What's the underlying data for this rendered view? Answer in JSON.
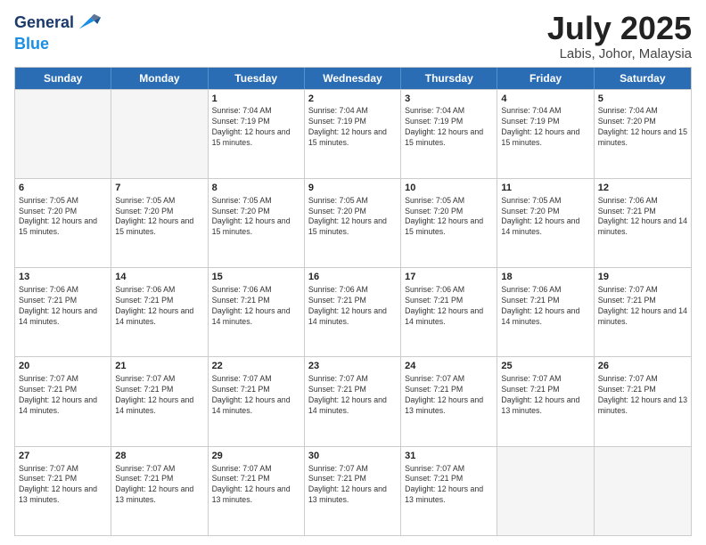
{
  "header": {
    "logo_line1": "General",
    "logo_line2": "Blue",
    "month_title": "July 2025",
    "location": "Labis, Johor, Malaysia"
  },
  "days_of_week": [
    "Sunday",
    "Monday",
    "Tuesday",
    "Wednesday",
    "Thursday",
    "Friday",
    "Saturday"
  ],
  "weeks": [
    [
      {
        "day": "",
        "sunrise": "",
        "sunset": "",
        "daylight": ""
      },
      {
        "day": "",
        "sunrise": "",
        "sunset": "",
        "daylight": ""
      },
      {
        "day": "1",
        "sunrise": "Sunrise: 7:04 AM",
        "sunset": "Sunset: 7:19 PM",
        "daylight": "Daylight: 12 hours and 15 minutes."
      },
      {
        "day": "2",
        "sunrise": "Sunrise: 7:04 AM",
        "sunset": "Sunset: 7:19 PM",
        "daylight": "Daylight: 12 hours and 15 minutes."
      },
      {
        "day": "3",
        "sunrise": "Sunrise: 7:04 AM",
        "sunset": "Sunset: 7:19 PM",
        "daylight": "Daylight: 12 hours and 15 minutes."
      },
      {
        "day": "4",
        "sunrise": "Sunrise: 7:04 AM",
        "sunset": "Sunset: 7:19 PM",
        "daylight": "Daylight: 12 hours and 15 minutes."
      },
      {
        "day": "5",
        "sunrise": "Sunrise: 7:04 AM",
        "sunset": "Sunset: 7:20 PM",
        "daylight": "Daylight: 12 hours and 15 minutes."
      }
    ],
    [
      {
        "day": "6",
        "sunrise": "Sunrise: 7:05 AM",
        "sunset": "Sunset: 7:20 PM",
        "daylight": "Daylight: 12 hours and 15 minutes."
      },
      {
        "day": "7",
        "sunrise": "Sunrise: 7:05 AM",
        "sunset": "Sunset: 7:20 PM",
        "daylight": "Daylight: 12 hours and 15 minutes."
      },
      {
        "day": "8",
        "sunrise": "Sunrise: 7:05 AM",
        "sunset": "Sunset: 7:20 PM",
        "daylight": "Daylight: 12 hours and 15 minutes."
      },
      {
        "day": "9",
        "sunrise": "Sunrise: 7:05 AM",
        "sunset": "Sunset: 7:20 PM",
        "daylight": "Daylight: 12 hours and 15 minutes."
      },
      {
        "day": "10",
        "sunrise": "Sunrise: 7:05 AM",
        "sunset": "Sunset: 7:20 PM",
        "daylight": "Daylight: 12 hours and 15 minutes."
      },
      {
        "day": "11",
        "sunrise": "Sunrise: 7:05 AM",
        "sunset": "Sunset: 7:20 PM",
        "daylight": "Daylight: 12 hours and 14 minutes."
      },
      {
        "day": "12",
        "sunrise": "Sunrise: 7:06 AM",
        "sunset": "Sunset: 7:21 PM",
        "daylight": "Daylight: 12 hours and 14 minutes."
      }
    ],
    [
      {
        "day": "13",
        "sunrise": "Sunrise: 7:06 AM",
        "sunset": "Sunset: 7:21 PM",
        "daylight": "Daylight: 12 hours and 14 minutes."
      },
      {
        "day": "14",
        "sunrise": "Sunrise: 7:06 AM",
        "sunset": "Sunset: 7:21 PM",
        "daylight": "Daylight: 12 hours and 14 minutes."
      },
      {
        "day": "15",
        "sunrise": "Sunrise: 7:06 AM",
        "sunset": "Sunset: 7:21 PM",
        "daylight": "Daylight: 12 hours and 14 minutes."
      },
      {
        "day": "16",
        "sunrise": "Sunrise: 7:06 AM",
        "sunset": "Sunset: 7:21 PM",
        "daylight": "Daylight: 12 hours and 14 minutes."
      },
      {
        "day": "17",
        "sunrise": "Sunrise: 7:06 AM",
        "sunset": "Sunset: 7:21 PM",
        "daylight": "Daylight: 12 hours and 14 minutes."
      },
      {
        "day": "18",
        "sunrise": "Sunrise: 7:06 AM",
        "sunset": "Sunset: 7:21 PM",
        "daylight": "Daylight: 12 hours and 14 minutes."
      },
      {
        "day": "19",
        "sunrise": "Sunrise: 7:07 AM",
        "sunset": "Sunset: 7:21 PM",
        "daylight": "Daylight: 12 hours and 14 minutes."
      }
    ],
    [
      {
        "day": "20",
        "sunrise": "Sunrise: 7:07 AM",
        "sunset": "Sunset: 7:21 PM",
        "daylight": "Daylight: 12 hours and 14 minutes."
      },
      {
        "day": "21",
        "sunrise": "Sunrise: 7:07 AM",
        "sunset": "Sunset: 7:21 PM",
        "daylight": "Daylight: 12 hours and 14 minutes."
      },
      {
        "day": "22",
        "sunrise": "Sunrise: 7:07 AM",
        "sunset": "Sunset: 7:21 PM",
        "daylight": "Daylight: 12 hours and 14 minutes."
      },
      {
        "day": "23",
        "sunrise": "Sunrise: 7:07 AM",
        "sunset": "Sunset: 7:21 PM",
        "daylight": "Daylight: 12 hours and 14 minutes."
      },
      {
        "day": "24",
        "sunrise": "Sunrise: 7:07 AM",
        "sunset": "Sunset: 7:21 PM",
        "daylight": "Daylight: 12 hours and 13 minutes."
      },
      {
        "day": "25",
        "sunrise": "Sunrise: 7:07 AM",
        "sunset": "Sunset: 7:21 PM",
        "daylight": "Daylight: 12 hours and 13 minutes."
      },
      {
        "day": "26",
        "sunrise": "Sunrise: 7:07 AM",
        "sunset": "Sunset: 7:21 PM",
        "daylight": "Daylight: 12 hours and 13 minutes."
      }
    ],
    [
      {
        "day": "27",
        "sunrise": "Sunrise: 7:07 AM",
        "sunset": "Sunset: 7:21 PM",
        "daylight": "Daylight: 12 hours and 13 minutes."
      },
      {
        "day": "28",
        "sunrise": "Sunrise: 7:07 AM",
        "sunset": "Sunset: 7:21 PM",
        "daylight": "Daylight: 12 hours and 13 minutes."
      },
      {
        "day": "29",
        "sunrise": "Sunrise: 7:07 AM",
        "sunset": "Sunset: 7:21 PM",
        "daylight": "Daylight: 12 hours and 13 minutes."
      },
      {
        "day": "30",
        "sunrise": "Sunrise: 7:07 AM",
        "sunset": "Sunset: 7:21 PM",
        "daylight": "Daylight: 12 hours and 13 minutes."
      },
      {
        "day": "31",
        "sunrise": "Sunrise: 7:07 AM",
        "sunset": "Sunset: 7:21 PM",
        "daylight": "Daylight: 12 hours and 13 minutes."
      },
      {
        "day": "",
        "sunrise": "",
        "sunset": "",
        "daylight": ""
      },
      {
        "day": "",
        "sunrise": "",
        "sunset": "",
        "daylight": ""
      }
    ]
  ]
}
